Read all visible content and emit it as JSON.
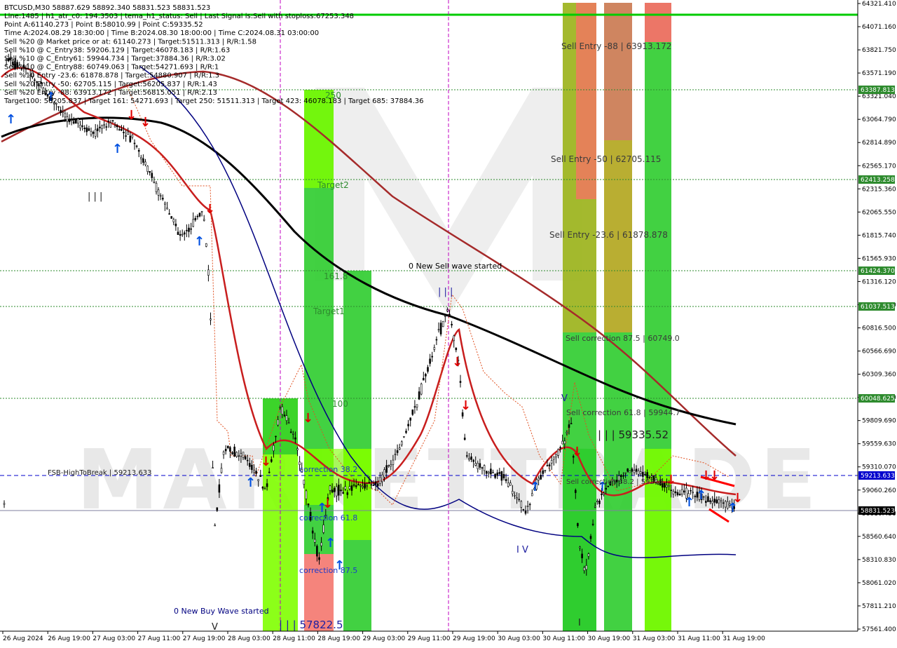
{
  "header": {
    "symbol_line": "BTCUSD,M30  58887.629 58892.340 58831.523 58831.523",
    "info_lines": [
      "Line:1485 | h1_atr_c0: 194.3503 | tema_h1_status: Sell | Last Signal is:Sell with stoploss:67253.348",
      "Point A:61140.273 | Point B:58010.99 | Point C:59335.52",
      "Time A:2024.08.29 18:30:00 | Time B:2024.08.30 18:00:00 | Time C:2024.08.31 03:00:00",
      "Sell %20 @ Market price or at: 61140.273 | Target:51511.313 | R/R:1.58",
      "Sell %10 @ C_Entry38: 59206.129 | Target:46078.183 | R/R:1.63",
      "Sell %10 @ C_Entry61: 59944.734 | Target:37884.36 | R/R:3.02",
      "Sell %10 @ C_Entry88: 60749.063 | Target:54271.693 | R/R:1",
      "Sell %10 Entry -23.6: 61878.878 | Target:54880.907 | R/R:1.3",
      "Sell %20 Entry -50: 62705.115 | Target:56205.837 | R/R:1.43",
      "Sell %20 Entry -88: 63913.172 | Target:56815.051 | R/R:2.13",
      "Target100: 56205.837 | Target 161: 54271.693 | Target 250: 51511.313 | Target 423: 46078.183 | Target 685: 37884.36"
    ]
  },
  "price_axis": {
    "ticks": [
      "64321.410",
      "64071.160",
      "63821.750",
      "63571.190",
      "63321.040",
      "63064.790",
      "62814.890",
      "62565.170",
      "62315.360",
      "62065.550",
      "61815.740",
      "61565.930",
      "61316.120",
      "61066.310",
      "60816.500",
      "60566.690",
      "60309.360",
      "60059.570",
      "59809.690",
      "59559.630",
      "59310.070",
      "59060.260",
      "58810.450",
      "58560.640",
      "58310.830",
      "58061.020",
      "57811.210",
      "57561.400"
    ],
    "badges": {
      "b63387": "63387.813",
      "b62413": "62413.258",
      "b61424": "61424.370",
      "b61037": "61037.513",
      "b60048": "60048.625",
      "b59213": "59213.633",
      "current": "58831.523"
    }
  },
  "time_axis": {
    "labels": [
      "26 Aug 2024",
      "26 Aug 19:00",
      "27 Aug 03:00",
      "27 Aug 11:00",
      "27 Aug 19:00",
      "28 Aug 03:00",
      "28 Aug 11:00",
      "28 Aug 19:00",
      "29 Aug 03:00",
      "29 Aug 11:00",
      "29 Aug 19:00",
      "30 Aug 03:00",
      "30 Aug 11:00",
      "30 Aug 19:00",
      "31 Aug 03:00",
      "31 Aug 11:00",
      "31 Aug 19:00"
    ]
  },
  "annotations": {
    "sell_entry_88": "Sell Entry -88 | 63913.172",
    "sell_entry_50": "Sell Entry -50 | 62705.115",
    "sell_entry_236": "Sell Entry -23.6 | 61878.878",
    "sell_correction_875": "Sell correction 87.5 | 60749.0",
    "sell_correction_618": "Sell correction 61.8 | 59944.7",
    "sell_correction_38": "Sell correction 38.2 | 59206",
    "point_c": "| | | 59335.52",
    "point_b": "| | | 57822.5",
    "new_sell_wave": "0 New Sell wave started",
    "new_buy_wave": "0 New Buy Wave started",
    "fsb_high": "FSB-HighToBreak | 59213.633",
    "t250": "250",
    "target2": "Target2",
    "t161": "161.8",
    "target1": "Target1",
    "t100": "100",
    "corr875": "correction 87.5",
    "corr618": "correction 61.8",
    "corr382": "correction 38.2",
    "wave_III": "| | |",
    "wave_IV": "I V",
    "wave_V": "V",
    "wave_V2": "V",
    "wave_III_top": "| | |",
    "wave_I": "I"
  },
  "colors": {
    "background": "#ffffff",
    "green_zone": "#2ecc2e",
    "lime_zone": "#7fff00",
    "red_zone": "#ff6b6b",
    "olive_zone": "#b5b52a",
    "ema_dark_red": "#a52a2a",
    "black_ma": "#000000",
    "navy_line": "#000080",
    "level_green": "#2e8b2e",
    "fsb_blue": "#0000cd"
  }
}
